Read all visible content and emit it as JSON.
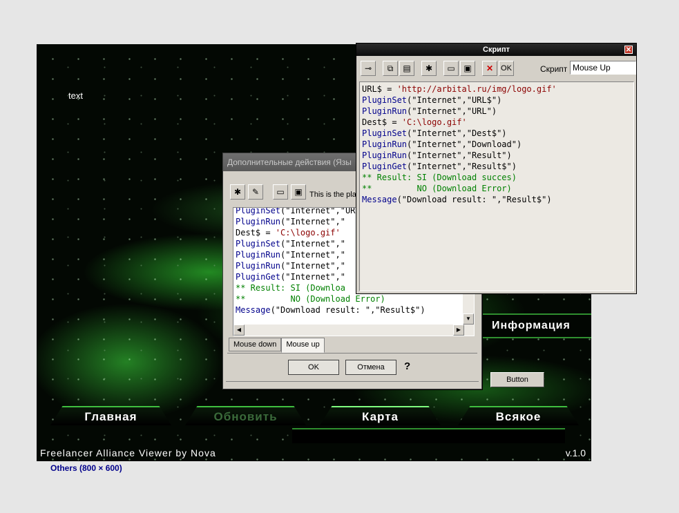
{
  "canvas": {
    "text_label": "text",
    "nav": {
      "main": "Главная",
      "refresh": "Обновить",
      "map": "Карта",
      "misc": "Всякое"
    },
    "info_panel": "Информация",
    "button": "Button",
    "footer_left": "Freelancer Alliance Viewer by Nova",
    "footer_right": "v.1.0"
  },
  "caption": "Others (800 × 600)",
  "dialog": {
    "title": "Дополнительные действия (Язы",
    "hint": "This is the plac",
    "toolbar_icons": [
      "wand-icon",
      "edit-icon",
      "open-folder-icon",
      "save-icon"
    ],
    "code_lines": [
      [
        {
          "t": "kw",
          "v": "PluginSet"
        },
        {
          "t": "tx",
          "v": "(\"Internet\",\"URL$\")"
        }
      ],
      [
        {
          "t": "kw",
          "v": "PluginRun"
        },
        {
          "t": "tx",
          "v": "(\"Internet\",\""
        }
      ],
      [
        {
          "t": "tx",
          "v": "Dest$ = "
        },
        {
          "t": "str",
          "v": "'C:\\logo.gif'"
        }
      ],
      [
        {
          "t": "kw",
          "v": "PluginSet"
        },
        {
          "t": "tx",
          "v": "(\"Internet\",\""
        }
      ],
      [
        {
          "t": "kw",
          "v": "PluginRun"
        },
        {
          "t": "tx",
          "v": "(\"Internet\",\""
        }
      ],
      [
        {
          "t": "kw",
          "v": "PluginRun"
        },
        {
          "t": "tx",
          "v": "(\"Internet\",\""
        }
      ],
      [
        {
          "t": "kw",
          "v": "PluginGet"
        },
        {
          "t": "tx",
          "v": "(\"Internet\",\""
        }
      ],
      [
        {
          "t": "cm",
          "v": "** Result: SI (Downloa"
        }
      ],
      [
        {
          "t": "cm",
          "v": "**         NO (Download Error)"
        }
      ],
      [
        {
          "t": "kw",
          "v": "Message"
        },
        {
          "t": "tx",
          "v": "(\"Download result: \",\"Result$\")"
        }
      ]
    ],
    "tabs": [
      "Mouse down",
      "Mouse up"
    ],
    "ok_label": "OK",
    "cancel_label": "Отмена",
    "help_label": "?"
  },
  "script_window": {
    "title": "Скрипт",
    "close_label": "✕",
    "event_label": "Скрипт",
    "event_value": "Mouse Up",
    "ok_label": "OK",
    "code_lines": [
      [
        {
          "t": "tx",
          "v": "URL$ = "
        },
        {
          "t": "str",
          "v": "'http://arbital.ru/img/logo.gif'"
        }
      ],
      [
        {
          "t": "kw",
          "v": "PluginSet"
        },
        {
          "t": "tx",
          "v": "(\"Internet\",\"URL$\")"
        }
      ],
      [
        {
          "t": "kw",
          "v": "PluginRun"
        },
        {
          "t": "tx",
          "v": "(\"Internet\",\"URL\")"
        }
      ],
      [
        {
          "t": "tx",
          "v": "Dest$ = "
        },
        {
          "t": "str",
          "v": "'C:\\logo.gif'"
        }
      ],
      [
        {
          "t": "kw",
          "v": "PluginSet"
        },
        {
          "t": "tx",
          "v": "(\"Internet\",\"Dest$\")"
        }
      ],
      [
        {
          "t": "kw",
          "v": "PluginRun"
        },
        {
          "t": "tx",
          "v": "(\"Internet\",\"Download\")"
        }
      ],
      [
        {
          "t": "kw",
          "v": "PluginRun"
        },
        {
          "t": "tx",
          "v": "(\"Internet\",\"Result\")"
        }
      ],
      [
        {
          "t": "kw",
          "v": "PluginGet"
        },
        {
          "t": "tx",
          "v": "(\"Internet\",\"Result$\")"
        }
      ],
      [
        {
          "t": "cm",
          "v": "** Result: SI (Download succes)"
        }
      ],
      [
        {
          "t": "cm",
          "v": "**         NO (Download Error)"
        }
      ],
      [
        {
          "t": "kw",
          "v": "Message"
        },
        {
          "t": "tx",
          "v": "(\"Download result: \",\"Result$\")"
        }
      ]
    ]
  }
}
